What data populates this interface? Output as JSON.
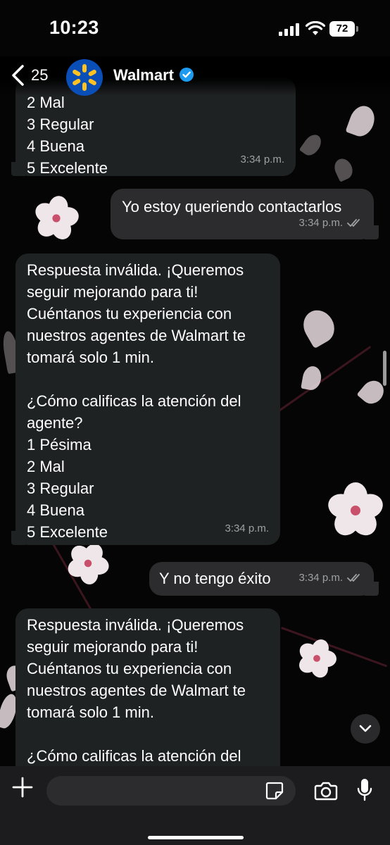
{
  "status_bar": {
    "time": "10:23",
    "battery": "72"
  },
  "header": {
    "back_count": "25",
    "contact_name": "Walmart"
  },
  "messages": [
    {
      "direction": "in",
      "lines": [
        "2 Mal",
        "3 Regular",
        "4 Buena",
        "5 Excelente"
      ],
      "time": "3:34 p.m."
    },
    {
      "direction": "out",
      "text": "Yo estoy queriendo contactarlos",
      "time": "3:34 p.m."
    },
    {
      "direction": "in",
      "text": "Respuesta inválida. ¡Queremos\nseguir mejorando para ti!\nCuéntanos tu experiencia con\nnuestros agentes de Walmart te\ntomará solo 1 min.\n\n¿Cómo calificas la atención del\nagente?\n1 Pésima\n2 Mal\n3 Regular\n4 Buena\n5 Excelente",
      "time": "3:34 p.m."
    },
    {
      "direction": "out",
      "text": "Y no tengo éxito",
      "time": "3:34 p.m."
    },
    {
      "direction": "in",
      "text": "Respuesta inválida. ¡Queremos\nseguir mejorando para ti!\nCuéntanos tu experiencia con\nnuestros agentes de Walmart te\ntomará solo 1 min.\n\n¿Cómo calificas la atención del"
    }
  ],
  "colors": {
    "accent_blue": "#0a4eb8",
    "verified_blue": "#1d9bf0",
    "walmart_yellow": "#ffc220",
    "incoming_bubble": "#1f2223",
    "outgoing_bubble": "#2c2c2e"
  },
  "icons": [
    "back-chevron-icon",
    "verified-badge-icon",
    "walmart-spark-icon",
    "scroll-down-icon",
    "plus-icon",
    "sticker-icon",
    "camera-icon",
    "mic-icon",
    "read-ticks-icon"
  ]
}
